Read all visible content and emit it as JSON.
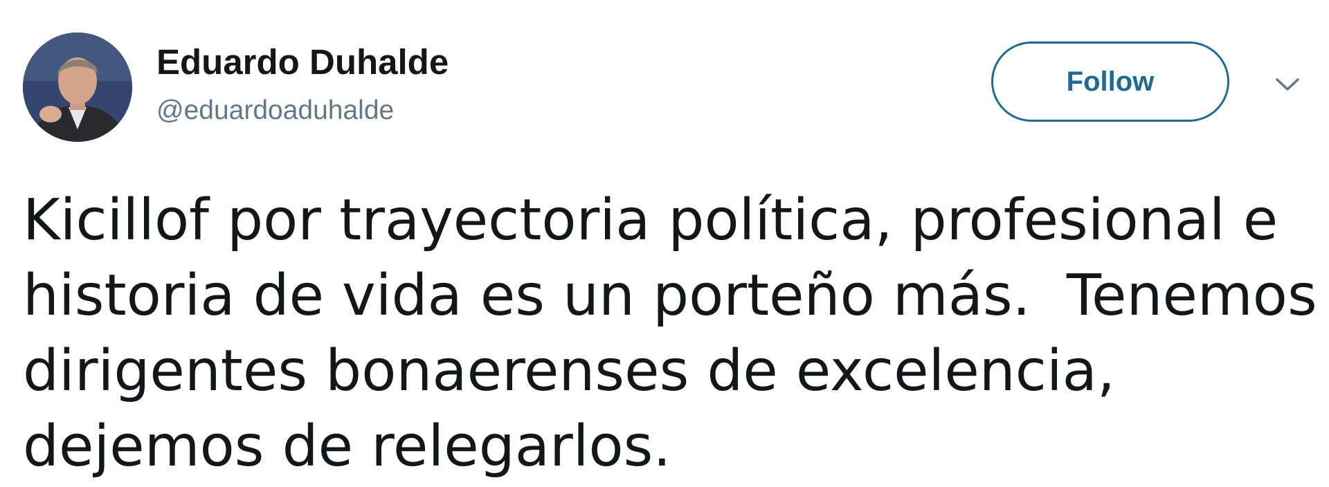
{
  "user": {
    "display_name": "Eduardo Duhalde",
    "handle": "@eduardoaduhalde"
  },
  "actions": {
    "follow_label": "Follow",
    "menu_icon": "chevron-down-icon"
  },
  "tweet": {
    "lines": [
      "Kicillof por trayectoria política, profesional e",
      "historia de vida es un porteño más.  Tenemos",
      "dirigentes bonaerenses de excelencia,",
      "dejemos de relegarlos."
    ]
  },
  "colors": {
    "accent": "#1f6a93",
    "text": "#14171a",
    "secondary": "#657786"
  }
}
